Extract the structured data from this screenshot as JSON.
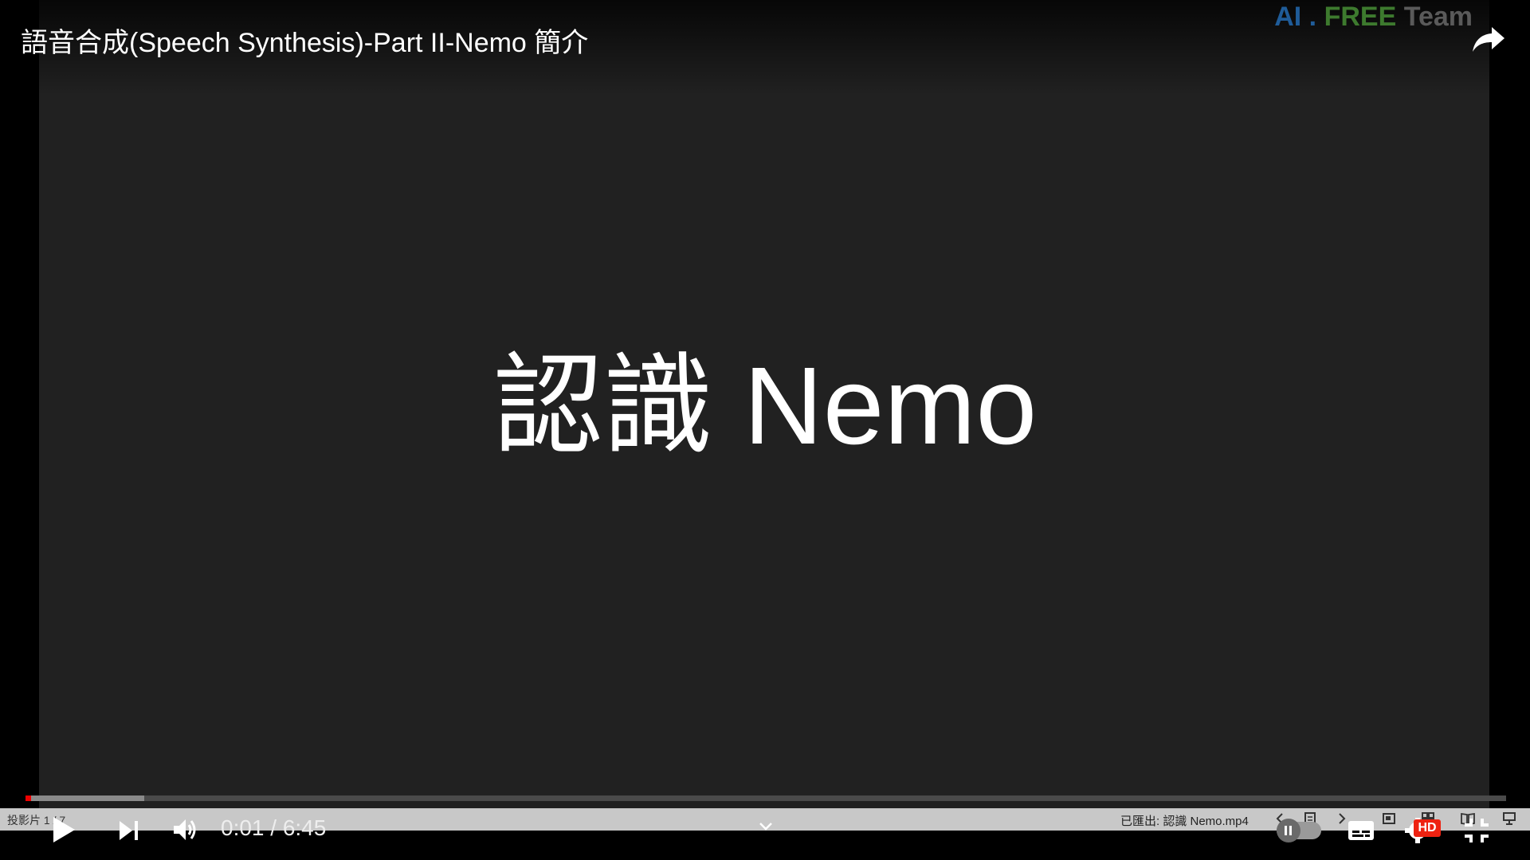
{
  "video": {
    "title": "語音合成(Speech Synthesis)-Part II-Nemo 簡介",
    "brand_ai": "AI",
    "brand_dot": ".",
    "brand_free": "FREE",
    "brand_team": "Team",
    "brand_colors": {
      "ai": "#1f5c99",
      "free": "#3d7a2e",
      "team": "#5a5a5a"
    }
  },
  "slide": {
    "main_text": "認識 Nemo"
  },
  "player": {
    "time_display": "0:01 / 6:45",
    "progress_played_fraction": 0.0035,
    "progress_buffered_fraction": 0.08,
    "hd_label": "HD",
    "autoplay": "paused"
  },
  "ppt_status": {
    "slide_counter": "投影片 1 / 7",
    "exported_label": "已匯出: 認識 Nemo.mp4"
  },
  "icons": {
    "share": "share-icon",
    "play": "play-icon",
    "next": "next-icon",
    "volume": "volume-icon",
    "chevron": "chevron-down-icon",
    "subtitles": "subtitles-icon",
    "settings": "gear-icon",
    "exit_fullscreen": "exit-fullscreen-icon"
  }
}
